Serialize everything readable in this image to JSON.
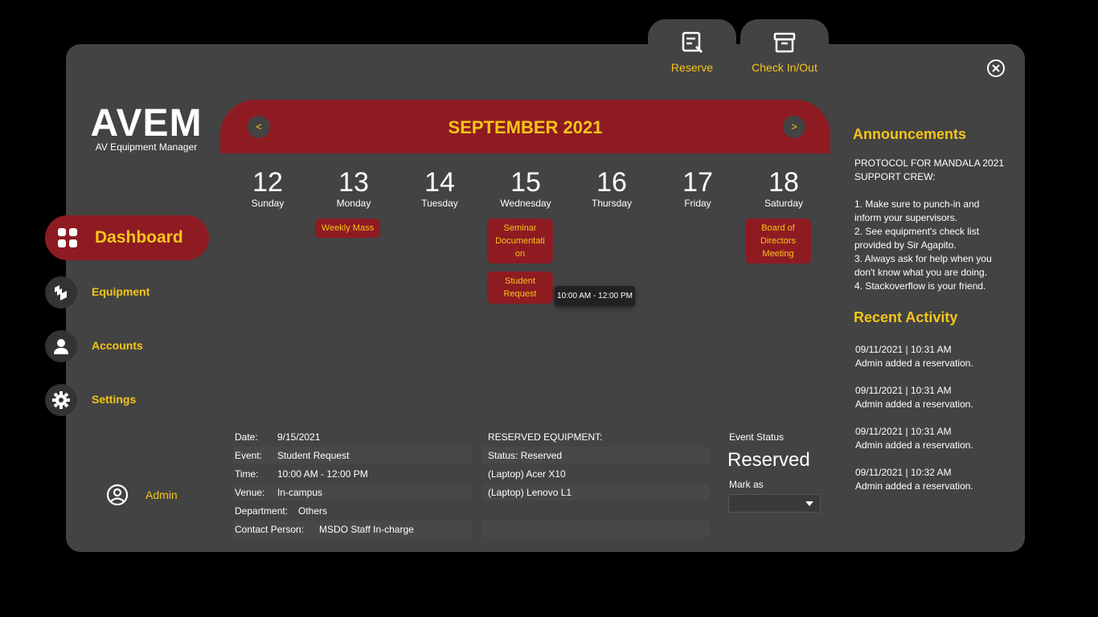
{
  "app": {
    "logo": "AVEM",
    "subtitle": "AV Equipment Manager"
  },
  "top_tabs": {
    "reserve": "Reserve",
    "checkin": "Check In/Out"
  },
  "sidebar": {
    "dashboard": "Dashboard",
    "equipment": "Equipment",
    "accounts": "Accounts",
    "settings": "Settings",
    "user": "Admin"
  },
  "calendar": {
    "month": "SEPTEMBER 2021",
    "prev": "<",
    "next": ">",
    "days": [
      {
        "num": "12",
        "name": "Sunday"
      },
      {
        "num": "13",
        "name": "Monday"
      },
      {
        "num": "14",
        "name": "Tuesday"
      },
      {
        "num": "15",
        "name": "Wednesday"
      },
      {
        "num": "16",
        "name": "Thursday"
      },
      {
        "num": "17",
        "name": "Friday"
      },
      {
        "num": "18",
        "name": "Saturday"
      }
    ],
    "events": {
      "weekly_mass": "Weekly Mass",
      "seminar": "Seminar Documentati on",
      "student_request": "Student Request",
      "board": "Board of Directors Meeting"
    },
    "tooltip": "10:00 AM - 12:00 PM"
  },
  "details": {
    "date_label": "Date:",
    "date": "9/15/2021",
    "event_label": "Event:",
    "event": "Student Request",
    "time_label": "Time:",
    "time": "10:00 AM - 12:00 PM",
    "venue_label": "Venue:",
    "venue": "In-campus",
    "dept_label": "Department:",
    "dept": "Others",
    "contact_label": "Contact Person:",
    "contact": "MSDO Staff In-charge"
  },
  "equipment": {
    "heading": "RESERVED EQUIPMENT:",
    "status": "Status: Reserved",
    "items": [
      "(Laptop) Acer X10",
      "(Laptop) Lenovo L1"
    ]
  },
  "event_status": {
    "label": "Event Status",
    "value": "Reserved",
    "mark_label": "Mark as",
    "mark_value": ""
  },
  "announcements": {
    "title": "Announcements",
    "lines": [
      "PROTOCOL FOR MANDALA 2021",
      "SUPPORT CREW:",
      "1. Make sure to punch-in and",
      "inform your supervisors.",
      "2. See equipment's check list",
      "provided by Sir Agapito.",
      "3. Always ask for help when you",
      "don't know what you are doing.",
      "4. Stackoverflow is your friend."
    ]
  },
  "recent_activity": {
    "title": "Recent Activity",
    "items": [
      {
        "time": "09/11/2021 | 10:31 AM",
        "text": "Admin added a reservation."
      },
      {
        "time": "09/11/2021 | 10:31 AM",
        "text": "Admin added a reservation."
      },
      {
        "time": "09/11/2021 | 10:31 AM",
        "text": "Admin added a reservation."
      },
      {
        "time": "09/11/2021 | 10:32 AM",
        "text": "Admin added a reservation."
      }
    ]
  },
  "colors": {
    "accent": "#f5c518",
    "brand": "#8e1b22",
    "panel": "#434343"
  }
}
